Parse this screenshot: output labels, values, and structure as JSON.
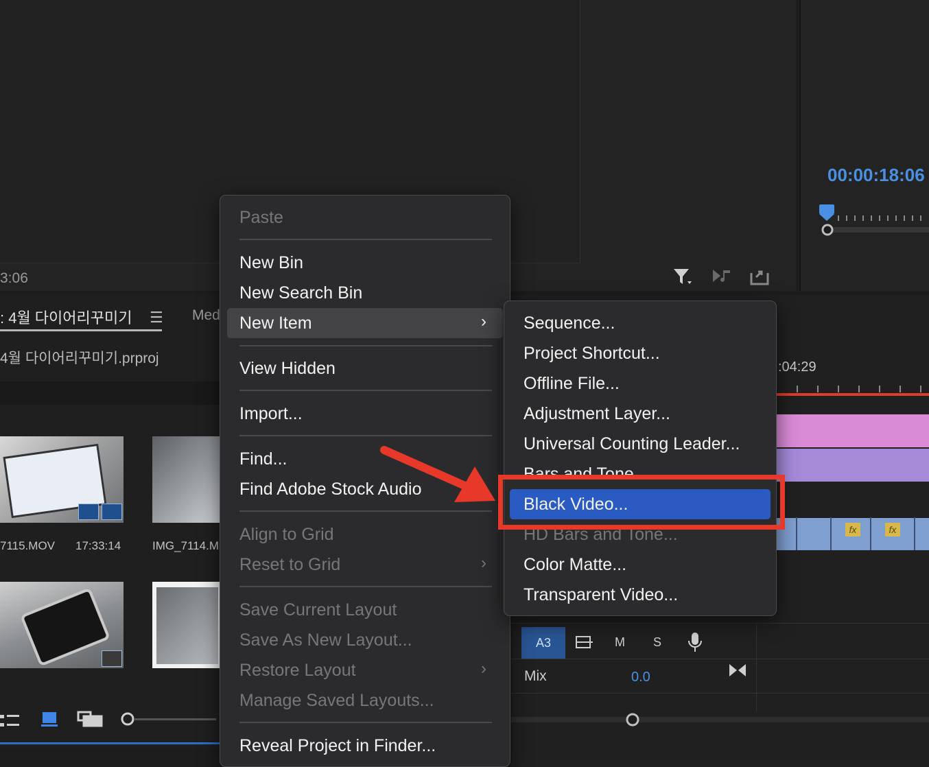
{
  "source_monitor": {
    "timecode": "3:06"
  },
  "program_monitor": {
    "timecode": "00:00:18:06"
  },
  "project_panel": {
    "tab_label": ": 4월 다이어리꾸미기",
    "media_tab_label": "Med",
    "project_file": "4월 다이어리꾸미기.prproj",
    "thumbnails": [
      {
        "name": "7115.MOV",
        "duration": "17:33:14"
      },
      {
        "name": "IMG_7114.M",
        "duration": ""
      },
      {
        "name": "",
        "duration": ""
      },
      {
        "name": "",
        "duration": ""
      }
    ]
  },
  "timeline": {
    "timecode": ":04:29",
    "track_label": "A3",
    "track_buttons": [
      "M",
      "S"
    ],
    "mix_label": "Mix",
    "mix_value": "0.0",
    "fx_label": "fx"
  },
  "context_menu": {
    "items": [
      {
        "label": "Paste",
        "enabled": false
      },
      {
        "label": "New Bin",
        "enabled": true
      },
      {
        "label": "New Search Bin",
        "enabled": true
      },
      {
        "label": "New Item",
        "enabled": true,
        "submenu": true,
        "highlighted": true
      },
      {
        "label": "View Hidden",
        "enabled": true
      },
      {
        "label": "Import...",
        "enabled": true
      },
      {
        "label": "Find...",
        "enabled": true
      },
      {
        "label": "Find Adobe Stock Audio",
        "enabled": true
      },
      {
        "label": "Align to Grid",
        "enabled": false
      },
      {
        "label": "Reset to Grid",
        "enabled": false,
        "submenu": true
      },
      {
        "label": "Save Current Layout",
        "enabled": false
      },
      {
        "label": "Save As New Layout...",
        "enabled": false
      },
      {
        "label": "Restore Layout",
        "enabled": false,
        "submenu": true
      },
      {
        "label": "Manage Saved Layouts...",
        "enabled": false
      },
      {
        "label": "Reveal Project in Finder...",
        "enabled": true
      }
    ]
  },
  "submenu": {
    "items": [
      {
        "label": "Sequence...",
        "enabled": true
      },
      {
        "label": "Project Shortcut...",
        "enabled": true
      },
      {
        "label": "Offline File...",
        "enabled": true
      },
      {
        "label": "Adjustment Layer...",
        "enabled": true
      },
      {
        "label": "Universal Counting Leader...",
        "enabled": true
      },
      {
        "label": "Bars and Tone...",
        "enabled": true
      },
      {
        "label": "Black Video...",
        "enabled": true,
        "highlighted": true
      },
      {
        "label": "HD Bars and Tone...",
        "enabled": false
      },
      {
        "label": "Color Matte...",
        "enabled": true
      },
      {
        "label": "Transparent Video...",
        "enabled": true
      }
    ]
  },
  "colors": {
    "highlight_blue": "#2a5bc2",
    "annotation_red": "#e8382a",
    "timecode_blue": "#4a90e2"
  }
}
